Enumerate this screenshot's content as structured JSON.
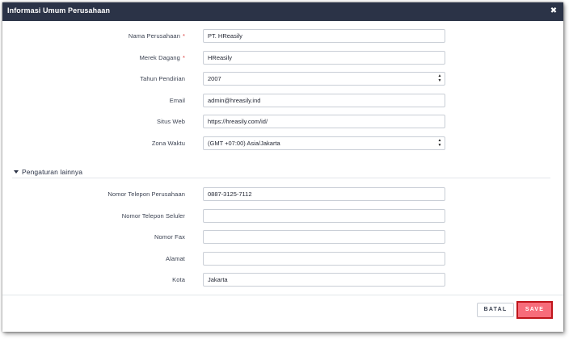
{
  "modal": {
    "title": "Informasi Umum Perusahaan",
    "close_icon": "close-icon",
    "close_glyph": "✖"
  },
  "fields": [
    {
      "label": "Nama Perusahaan",
      "required": true,
      "value": "PT. HReasily",
      "type": "text"
    },
    {
      "label": "Merek Dagang",
      "required": true,
      "value": "HReasily",
      "type": "text"
    },
    {
      "label": "Tahun Pendirian",
      "required": false,
      "value": "2007",
      "type": "select"
    },
    {
      "label": "Email",
      "required": false,
      "value": "admin@hreasily.ind",
      "type": "text"
    },
    {
      "label": "Situs Web",
      "required": false,
      "value": "https://hreasily.com/id/",
      "type": "text"
    },
    {
      "label": "Zona Waktu",
      "required": false,
      "value": "(GMT +07:00) Asia/Jakarta",
      "type": "select"
    }
  ],
  "other_section": {
    "title": "Pengaturan lainnya",
    "toggle_icon": "caret-down-icon",
    "fields": [
      {
        "label": "Nomor Telepon Perusahaan",
        "value": "0887-3125-7112"
      },
      {
        "label": "Nomor Telepon Seluler",
        "value": ""
      },
      {
        "label": "Nomor Fax",
        "value": ""
      },
      {
        "label": "Alamat",
        "value": ""
      },
      {
        "label": "Kota",
        "value": "Jakarta"
      }
    ]
  },
  "footer": {
    "cancel_label": "BATAL",
    "save_label": "SAVE"
  },
  "colors": {
    "header_bg": "#2b3347",
    "required": "#d93636",
    "save_bg": "#f76c7a",
    "save_border": "#c0151b"
  }
}
